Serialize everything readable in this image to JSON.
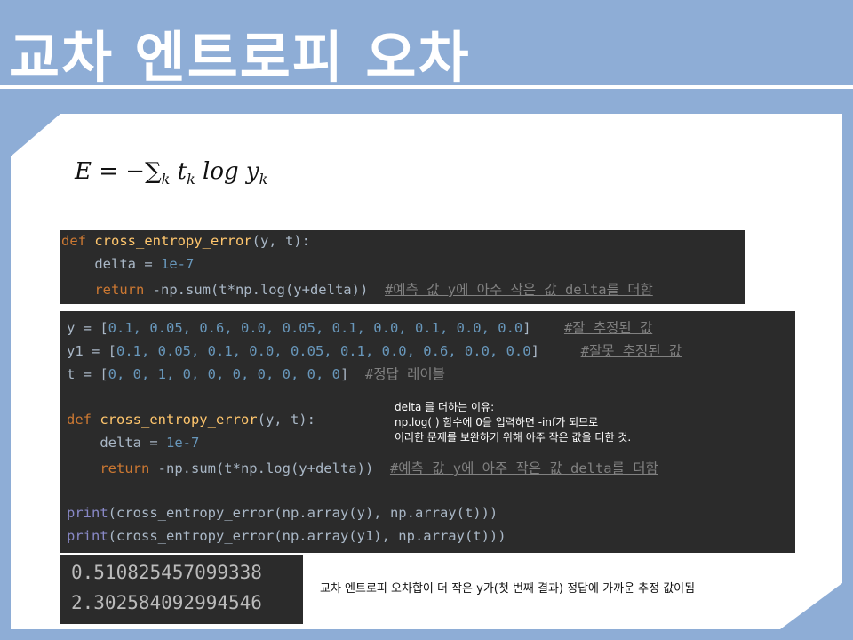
{
  "slide": {
    "title": "교차 엔트로피 오차",
    "formula": {
      "E": "E",
      "equals": " = −",
      "sum": "∑",
      "k_sub": "k",
      "t": " t",
      "t_sub": "k",
      "log": " log y",
      "y_sub": "k"
    },
    "code_top": {
      "def_kw": "def ",
      "fn_name": "cross_entropy_error",
      "params": "(y, t):",
      "delta_line": "    delta = ",
      "delta_val": "1e-7",
      "return_kw": "    return ",
      "return_expr": "-np.sum(t*np.log(y+delta))",
      "return_comment": "#예측 값 y에 아주 작은 값 delta를 더함"
    },
    "code_main": {
      "y_assign": "y = [",
      "y_values": "0.1, 0.05, 0.6, 0.0, 0.05, 0.1, 0.0, 0.1, 0.0, 0.0",
      "y_close": "]",
      "y_comment": "#잘 추정된 값",
      "y1_assign": "y1 = [",
      "y1_values": "0.1, 0.05, 0.1, 0.0, 0.05, 0.1, 0.0, 0.6, 0.0, 0.0",
      "y1_close": "]",
      "y1_comment": "#잘못 추정된 값",
      "t_assign": "t = [",
      "t_values": "0, 0, 1, 0, 0, 0, 0, 0, 0, 0",
      "t_close": "]",
      "t_comment": "#정답 레이블",
      "def_kw": "def ",
      "fn_name": "cross_entropy_error",
      "params": "(y, t):",
      "delta_line": "    delta = ",
      "delta_val": "1e-7",
      "return_kw": "    return ",
      "return_expr": "-np.sum(t*np.log(y+delta))",
      "return_comment": "#예측 값 y에 아주 작은 값 delta를 더함",
      "print_kw": "print",
      "print1_args": "(cross_entropy_error(np.array(y), np.array(t)))",
      "print2_args": "(cross_entropy_error(np.array(y1), np.array(t)))"
    },
    "note": {
      "line1": "delta 를 더하는 이유:",
      "line2": "np.log( ) 함수에 0을 입력하면 -inf가 되므로",
      "line3": "이러한 문제를 보완하기 위해 아주 작은 값을 더한 것."
    },
    "output": {
      "result1": "0.510825457099338",
      "result2": "2.302584092994546"
    },
    "caption": "교차 엔트로피 오차합이 더 작은 y가(첫 번째 결과) 정답에 가까운 추정 값이됨"
  }
}
